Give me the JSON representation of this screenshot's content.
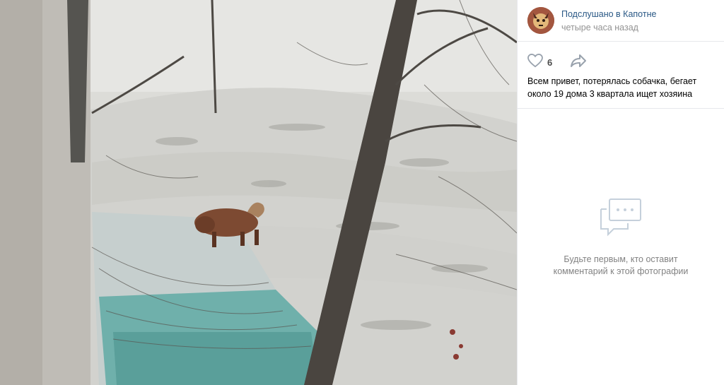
{
  "photo": {
    "subject": "dog-on-snow-photo"
  },
  "post": {
    "author": "Подслушано в Капотне",
    "time": "четыре часа назад",
    "likes": "6",
    "text": "Всем привет, потерялась собачка, бегает около 19 дома 3 квартала ищет хозяина"
  },
  "comments": {
    "empty_line1": "Будьте первым, кто оставит",
    "empty_line2": "комментарий к этой фотографии"
  },
  "icons": {
    "like": "heart-icon",
    "share": "share-arrow-icon",
    "comments": "comment-bubble-icon"
  },
  "colors": {
    "link": "#2a5885",
    "muted": "#939393",
    "divider": "#e7e8ec",
    "icon": "#99a2ad"
  }
}
